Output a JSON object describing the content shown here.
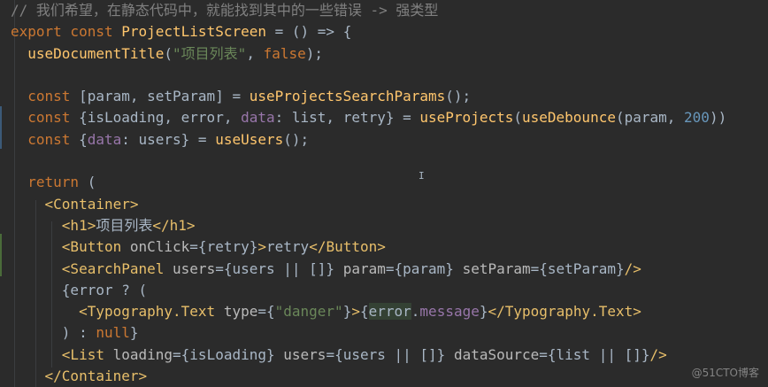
{
  "editor": {
    "lines": [
      [
        {
          "c": "t-comment",
          "t": "// 我们希望，在静态代码中，就能找到其中的一些错误 -> 强类型"
        }
      ],
      [
        {
          "c": "t-kw",
          "t": "export const "
        },
        {
          "c": "t-fn",
          "t": "ProjectListScreen"
        },
        {
          "c": "t-plain",
          "t": " = () => {"
        }
      ],
      [
        {
          "c": "t-plain",
          "t": "  "
        },
        {
          "c": "t-fn",
          "t": "useDocumentTitle"
        },
        {
          "c": "t-plain",
          "t": "("
        },
        {
          "c": "t-str",
          "t": "\"项目列表\""
        },
        {
          "c": "t-plain",
          "t": ", "
        },
        {
          "c": "t-kw",
          "t": "false"
        },
        {
          "c": "t-plain",
          "t": ");"
        }
      ],
      [
        {
          "c": "t-plain",
          "t": ""
        }
      ],
      [
        {
          "c": "t-plain",
          "t": "  "
        },
        {
          "c": "t-kw",
          "t": "const "
        },
        {
          "c": "t-plain",
          "t": "[param, setParam] = "
        },
        {
          "c": "t-fn",
          "t": "useProjectsSearchParams"
        },
        {
          "c": "t-plain",
          "t": "();"
        }
      ],
      [
        {
          "c": "t-plain",
          "t": "  "
        },
        {
          "c": "t-kw",
          "t": "const "
        },
        {
          "c": "t-plain",
          "t": "{isLoading, error, "
        },
        {
          "c": "t-prop",
          "t": "data"
        },
        {
          "c": "t-plain",
          "t": ": list, retry} = "
        },
        {
          "c": "t-fn",
          "t": "useProjects"
        },
        {
          "c": "t-plain",
          "t": "("
        },
        {
          "c": "t-fn",
          "t": "useDebounce"
        },
        {
          "c": "t-plain",
          "t": "(param, "
        },
        {
          "c": "t-num",
          "t": "200"
        },
        {
          "c": "t-plain",
          "t": "))"
        }
      ],
      [
        {
          "c": "t-plain",
          "t": "  "
        },
        {
          "c": "t-kw",
          "t": "const "
        },
        {
          "c": "t-plain",
          "t": "{"
        },
        {
          "c": "t-prop",
          "t": "data"
        },
        {
          "c": "t-plain",
          "t": ": users} = "
        },
        {
          "c": "t-fn",
          "t": "useUsers"
        },
        {
          "c": "t-plain",
          "t": "();"
        }
      ],
      [
        {
          "c": "t-plain",
          "t": ""
        }
      ],
      [
        {
          "c": "t-plain",
          "t": "  "
        },
        {
          "c": "t-kw",
          "t": "return "
        },
        {
          "c": "t-plain",
          "t": "("
        }
      ],
      [
        {
          "c": "t-plain",
          "t": "    "
        },
        {
          "c": "t-tag",
          "t": "<Container>"
        }
      ],
      [
        {
          "c": "t-plain",
          "t": "      "
        },
        {
          "c": "t-tag",
          "t": "<h1>"
        },
        {
          "c": "t-plain",
          "t": "项目列表"
        },
        {
          "c": "t-tag",
          "t": "</h1>"
        }
      ],
      [
        {
          "c": "t-plain",
          "t": "      "
        },
        {
          "c": "t-tag",
          "t": "<Button "
        },
        {
          "c": "t-attr",
          "t": "onClick"
        },
        {
          "c": "t-plain",
          "t": "={"
        },
        {
          "c": "t-plain",
          "t": "retry"
        },
        {
          "c": "t-plain",
          "t": "}"
        },
        {
          "c": "t-tag",
          "t": ">"
        },
        {
          "c": "t-plain",
          "t": "retry"
        },
        {
          "c": "t-tag",
          "t": "</Button>"
        }
      ],
      [
        {
          "c": "t-plain",
          "t": "      "
        },
        {
          "c": "t-tag",
          "t": "<SearchPanel "
        },
        {
          "c": "t-attr",
          "t": "users"
        },
        {
          "c": "t-plain",
          "t": "={users || []} "
        },
        {
          "c": "t-attr",
          "t": "param"
        },
        {
          "c": "t-plain",
          "t": "={param} "
        },
        {
          "c": "t-attr",
          "t": "setParam"
        },
        {
          "c": "t-plain",
          "t": "={setParam}"
        },
        {
          "c": "t-tag",
          "t": "/>"
        }
      ],
      [
        {
          "c": "t-plain",
          "t": "      {error ? ("
        }
      ],
      [
        {
          "c": "t-plain",
          "t": "        "
        },
        {
          "c": "t-tag",
          "t": "<Typography.Text "
        },
        {
          "c": "t-attr",
          "t": "type"
        },
        {
          "c": "t-plain",
          "t": "={"
        },
        {
          "c": "t-str",
          "t": "\"danger\""
        },
        {
          "c": "t-plain",
          "t": "}"
        },
        {
          "c": "t-tag",
          "t": ">"
        },
        {
          "c": "t-plain",
          "t": "{"
        },
        {
          "c": "t-hl",
          "t": "error"
        },
        {
          "c": "t-plain",
          "t": "."
        },
        {
          "c": "t-prop",
          "t": "message"
        },
        {
          "c": "t-plain",
          "t": "}"
        },
        {
          "c": "t-tag",
          "t": "</Typography.Text>"
        }
      ],
      [
        {
          "c": "t-plain",
          "t": "      ) : "
        },
        {
          "c": "t-kw",
          "t": "null"
        },
        {
          "c": "t-plain",
          "t": "}"
        }
      ],
      [
        {
          "c": "t-plain",
          "t": "      "
        },
        {
          "c": "t-tag",
          "t": "<List "
        },
        {
          "c": "t-attr",
          "t": "loading"
        },
        {
          "c": "t-plain",
          "t": "={isLoading} "
        },
        {
          "c": "t-attr",
          "t": "users"
        },
        {
          "c": "t-plain",
          "t": "={users || []} "
        },
        {
          "c": "t-attr",
          "t": "dataSource"
        },
        {
          "c": "t-plain",
          "t": "={list || []}"
        },
        {
          "c": "t-tag",
          "t": "/>"
        }
      ],
      [
        {
          "c": "t-plain",
          "t": "    "
        },
        {
          "c": "t-tag",
          "t": "</Container>"
        }
      ]
    ]
  },
  "cursor_glyph": "I",
  "watermark": "@51CTO博客",
  "colors": {
    "background": "#2b2b2b",
    "keyword": "#cc7832",
    "function": "#ffc66d",
    "string": "#6a8759",
    "number": "#6897bb",
    "property": "#9876aa",
    "tag": "#e8bf6a",
    "comment": "#808080"
  }
}
